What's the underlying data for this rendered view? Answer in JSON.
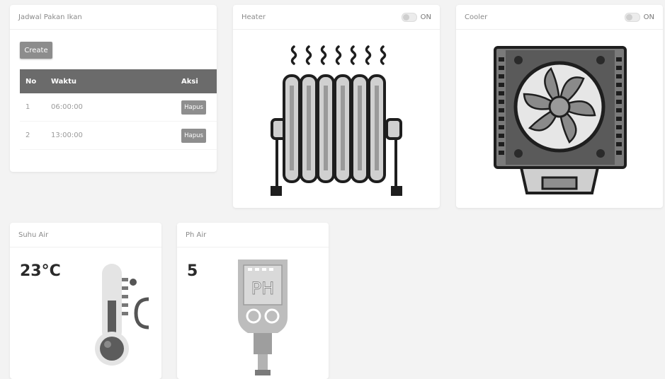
{
  "jadwal": {
    "title": "Jadwal Pakan Ikan",
    "create_label": "Create",
    "columns": [
      "No",
      "Waktu",
      "Aksi"
    ],
    "rows": [
      {
        "no": "1",
        "waktu": "06:00:00",
        "aksi": "Hapus"
      },
      {
        "no": "2",
        "waktu": "13:00:00",
        "aksi": "Hapus"
      }
    ]
  },
  "heater": {
    "title": "Heater",
    "toggle_label": "ON",
    "icon": "radiator-heater-icon"
  },
  "cooler": {
    "title": "Cooler",
    "toggle_label": "ON",
    "icon": "cpu-cooler-fan-icon"
  },
  "suhu": {
    "title": "Suhu Air",
    "value": "23°C",
    "icon": "thermometer-icon"
  },
  "ph": {
    "title": "Ph Air",
    "value": "5",
    "icon": "ph-meter-icon",
    "icon_text": "PH"
  }
}
